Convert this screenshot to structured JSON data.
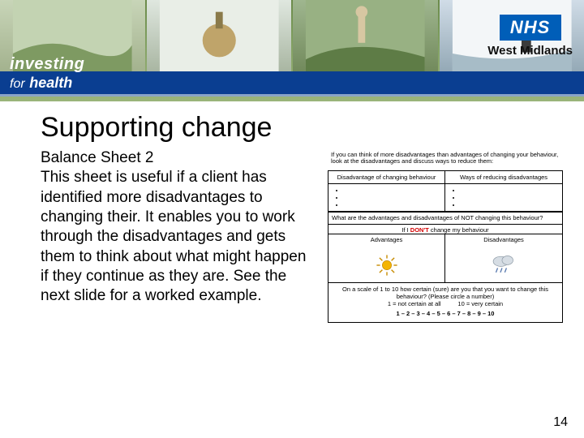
{
  "banner": {
    "investing_top": "investing",
    "investing_for": "for",
    "investing_health": "health",
    "nhs_logo": "NHS",
    "nhs_region": "West Midlands"
  },
  "title": "Supporting change",
  "body": "Balance Sheet 2\nThis sheet is useful if a client has identified more disadvantages to changing their.  It enables you to work through the disadvantages and gets them to think about what might happen if they continue as they are.  See the next slide for a worked example.",
  "worksheet": {
    "intro": "If you can think of more disadvantages than advantages of changing your behaviour, look at the disadvantages and discuss ways to reduce them:",
    "col1_head": "Disadvantage of changing behaviour",
    "col2_head": "Ways of reducing disadvantages",
    "mid_question": "What are the advantages and disadvantages of NOT changing this behaviour?",
    "change_line_prefix": "If I ",
    "change_line_dont": "DON'T",
    "change_line_suffix": " change my behaviour",
    "adv_label": "Advantages",
    "dis_label": "Disadvantages",
    "scale_q": "On a scale of 1 to 10 how certain (sure) are you that you want to change this behaviour? (Please circle a number)",
    "scale_low": "1 = not certain at all",
    "scale_high": "10 = very certain",
    "scale_numbers": "1 – 2 – 3 – 4 – 5 – 6 – 7 – 8 – 9 – 10"
  },
  "page_number": "14"
}
